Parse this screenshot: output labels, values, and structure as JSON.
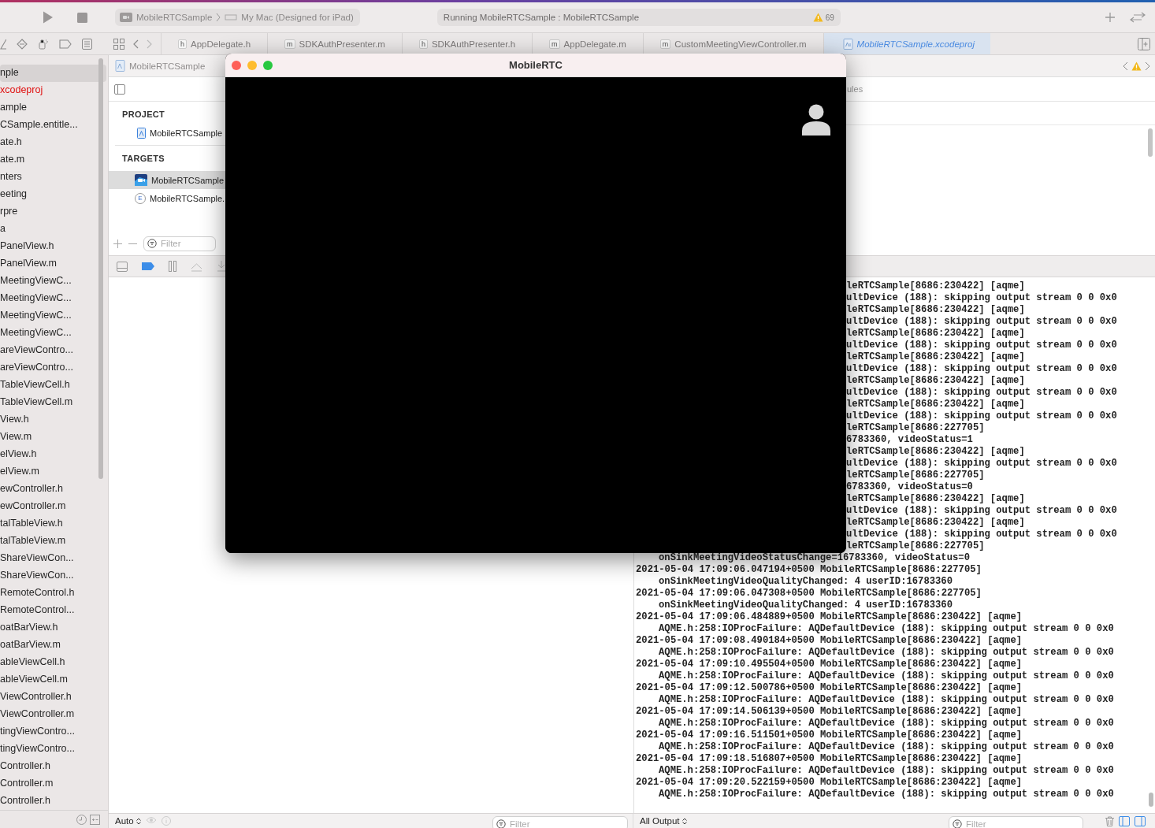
{
  "toolbar": {
    "scheme": "MobileRTCSample",
    "destination": "My Mac (Designed for iPad)",
    "status": "Running MobileRTCSample : MobileRTCSample",
    "warning_count": "69"
  },
  "tabs": [
    {
      "kind": "file",
      "badge": "h",
      "label": "AppDelegate.h",
      "selected": false
    },
    {
      "kind": "file",
      "badge": "m",
      "label": "SDKAuthPresenter.m",
      "selected": false
    },
    {
      "kind": "file",
      "badge": "h",
      "label": "SDKAuthPresenter.h",
      "selected": false
    },
    {
      "kind": "file",
      "badge": "m",
      "label": "AppDelegate.m",
      "selected": false
    },
    {
      "kind": "file",
      "badge": "m",
      "label": "CustomMeetingViewController.m",
      "selected": false
    },
    {
      "kind": "project",
      "label": "MobileRTCSample.xcodeproj",
      "selected": true
    }
  ],
  "navigator": {
    "items": [
      {
        "label": "nple",
        "selected": true,
        "missing": false
      },
      {
        "label": "xcodeproj",
        "selected": false,
        "missing": true
      },
      {
        "label": "ample",
        "selected": false,
        "missing": false
      },
      {
        "label": "CSample.entitle...",
        "selected": false,
        "missing": false
      },
      {
        "label": "ate.h",
        "selected": false,
        "missing": false
      },
      {
        "label": "ate.m",
        "selected": false,
        "missing": false
      },
      {
        "label": "nters",
        "selected": false,
        "missing": false
      },
      {
        "label": "eeting",
        "selected": false,
        "missing": false
      },
      {
        "label": "rpre",
        "selected": false,
        "missing": false
      },
      {
        "label": "a",
        "selected": false,
        "missing": false
      },
      {
        "label": "PanelView.h",
        "selected": false,
        "missing": false
      },
      {
        "label": "PanelView.m",
        "selected": false,
        "missing": false
      },
      {
        "label": "MeetingViewC...",
        "selected": false,
        "missing": false
      },
      {
        "label": "MeetingViewC...",
        "selected": false,
        "missing": false
      },
      {
        "label": "MeetingViewC...",
        "selected": false,
        "missing": false
      },
      {
        "label": "MeetingViewC...",
        "selected": false,
        "missing": false
      },
      {
        "label": "areViewContro...",
        "selected": false,
        "missing": false
      },
      {
        "label": "areViewContro...",
        "selected": false,
        "missing": false
      },
      {
        "label": "TableViewCell.h",
        "selected": false,
        "missing": false
      },
      {
        "label": "TableViewCell.m",
        "selected": false,
        "missing": false
      },
      {
        "label": "View.h",
        "selected": false,
        "missing": false
      },
      {
        "label": "View.m",
        "selected": false,
        "missing": false
      },
      {
        "label": "elView.h",
        "selected": false,
        "missing": false
      },
      {
        "label": "elView.m",
        "selected": false,
        "missing": false
      },
      {
        "label": "ewController.h",
        "selected": false,
        "missing": false
      },
      {
        "label": "ewController.m",
        "selected": false,
        "missing": false
      },
      {
        "label": "talTableView.h",
        "selected": false,
        "missing": false
      },
      {
        "label": "talTableView.m",
        "selected": false,
        "missing": false
      },
      {
        "label": "ShareViewCon...",
        "selected": false,
        "missing": false
      },
      {
        "label": "ShareViewCon...",
        "selected": false,
        "missing": false
      },
      {
        "label": "RemoteControl.h",
        "selected": false,
        "missing": false
      },
      {
        "label": "RemoteControl...",
        "selected": false,
        "missing": false
      },
      {
        "label": "oatBarView.h",
        "selected": false,
        "missing": false
      },
      {
        "label": "oatBarView.m",
        "selected": false,
        "missing": false
      },
      {
        "label": "ableViewCell.h",
        "selected": false,
        "missing": false
      },
      {
        "label": "ableViewCell.m",
        "selected": false,
        "missing": false
      },
      {
        "label": "ViewController.h",
        "selected": false,
        "missing": false
      },
      {
        "label": "ViewController.m",
        "selected": false,
        "missing": false
      },
      {
        "label": "tingViewContro...",
        "selected": false,
        "missing": false
      },
      {
        "label": "tingViewContro...",
        "selected": false,
        "missing": false
      },
      {
        "label": "Controller.h",
        "selected": false,
        "missing": false
      },
      {
        "label": "Controller.m",
        "selected": false,
        "missing": false
      },
      {
        "label": "Controller.h",
        "selected": false,
        "missing": false
      }
    ]
  },
  "jump_bar": {
    "label": "MobileRTCSample"
  },
  "project_panel": {
    "project_header": "PROJECT",
    "project": "MobileRTCSample",
    "targets_header": "TARGETS",
    "targets": [
      {
        "kind": "app",
        "label": "MobileRTCSample",
        "selected": true
      },
      {
        "kind": "extension",
        "badge": "E",
        "label": "MobileRTCSample.",
        "selected": false
      }
    ],
    "filter_placeholder": "Filter"
  },
  "settings_tab": "ules",
  "variables_bar": {
    "mode": "Auto",
    "filter_placeholder": "Filter"
  },
  "console": {
    "covered_lines": [
      "leRTCSample[8686:230422] [aqme]",
      "ultDevice (188): skipping output stream 0 0 0x0",
      "leRTCSample[8686:230422] [aqme]",
      "ultDevice (188): skipping output stream 0 0 0x0",
      "leRTCSample[8686:230422] [aqme]",
      "ultDevice (188): skipping output stream 0 0 0x0",
      "leRTCSample[8686:230422] [aqme]",
      "ultDevice (188): skipping output stream 0 0 0x0",
      "leRTCSample[8686:230422] [aqme]",
      "ultDevice (188): skipping output stream 0 0 0x0",
      "leRTCSample[8686:230422] [aqme]",
      "ultDevice (188): skipping output stream 0 0 0x0",
      "leRTCSample[8686:227705]",
      "6783360, videoStatus=1",
      "leRTCSample[8686:230422] [aqme]",
      "ultDevice (188): skipping output stream 0 0 0x0",
      "leRTCSample[8686:227705]",
      "6783360, videoStatus=0",
      "leRTCSample[8686:230422] [aqme]",
      "ultDevice (188): skipping output stream 0 0 0x0",
      "leRTCSample[8686:230422] [aqme]",
      "ultDevice (188): skipping output stream 0 0 0x0",
      "leRTCSample[8686:227705]"
    ],
    "lines": [
      {
        "kind": "detail",
        "text": "onSinkMeetingVideoStatusChange=16783360, videoStatus=0"
      },
      {
        "kind": "entry",
        "text": "2021-05-04 17:09:06.047194+0500 MobileRTCSample[8686:227705]"
      },
      {
        "kind": "detail",
        "text": "onSinkMeetingVideoQualityChanged: 4 userID:16783360"
      },
      {
        "kind": "entry",
        "text": "2021-05-04 17:09:06.047308+0500 MobileRTCSample[8686:227705]"
      },
      {
        "kind": "detail",
        "text": "onSinkMeetingVideoQualityChanged: 4 userID:16783360"
      },
      {
        "kind": "entry",
        "text": "2021-05-04 17:09:06.484889+0500 MobileRTCSample[8686:230422] [aqme]"
      },
      {
        "kind": "detail",
        "text": "AQME.h:258:IOProcFailure: AQDefaultDevice (188): skipping output stream 0 0 0x0"
      },
      {
        "kind": "entry",
        "text": "2021-05-04 17:09:08.490184+0500 MobileRTCSample[8686:230422] [aqme]"
      },
      {
        "kind": "detail",
        "text": "AQME.h:258:IOProcFailure: AQDefaultDevice (188): skipping output stream 0 0 0x0"
      },
      {
        "kind": "entry",
        "text": "2021-05-04 17:09:10.495504+0500 MobileRTCSample[8686:230422] [aqme]"
      },
      {
        "kind": "detail",
        "text": "AQME.h:258:IOProcFailure: AQDefaultDevice (188): skipping output stream 0 0 0x0"
      },
      {
        "kind": "entry",
        "text": "2021-05-04 17:09:12.500786+0500 MobileRTCSample[8686:230422] [aqme]"
      },
      {
        "kind": "detail",
        "text": "AQME.h:258:IOProcFailure: AQDefaultDevice (188): skipping output stream 0 0 0x0"
      },
      {
        "kind": "entry",
        "text": "2021-05-04 17:09:14.506139+0500 MobileRTCSample[8686:230422] [aqme]"
      },
      {
        "kind": "detail",
        "text": "AQME.h:258:IOProcFailure: AQDefaultDevice (188): skipping output stream 0 0 0x0"
      },
      {
        "kind": "entry",
        "text": "2021-05-04 17:09:16.511501+0500 MobileRTCSample[8686:230422] [aqme]"
      },
      {
        "kind": "detail",
        "text": "AQME.h:258:IOProcFailure: AQDefaultDevice (188): skipping output stream 0 0 0x0"
      },
      {
        "kind": "entry",
        "text": "2021-05-04 17:09:18.516807+0500 MobileRTCSample[8686:230422] [aqme]"
      },
      {
        "kind": "detail",
        "text": "AQME.h:258:IOProcFailure: AQDefaultDevice (188): skipping output stream 0 0 0x0"
      },
      {
        "kind": "entry",
        "text": "2021-05-04 17:09:20.522159+0500 MobileRTCSample[8686:230422] [aqme]"
      },
      {
        "kind": "detail",
        "text": "AQME.h:258:IOProcFailure: AQDefaultDevice (188): skipping output stream 0 0 0x0"
      }
    ]
  },
  "console_bar": {
    "mode": "All Output",
    "filter_placeholder": "Filter"
  },
  "app_window": {
    "title": "MobileRTC"
  }
}
